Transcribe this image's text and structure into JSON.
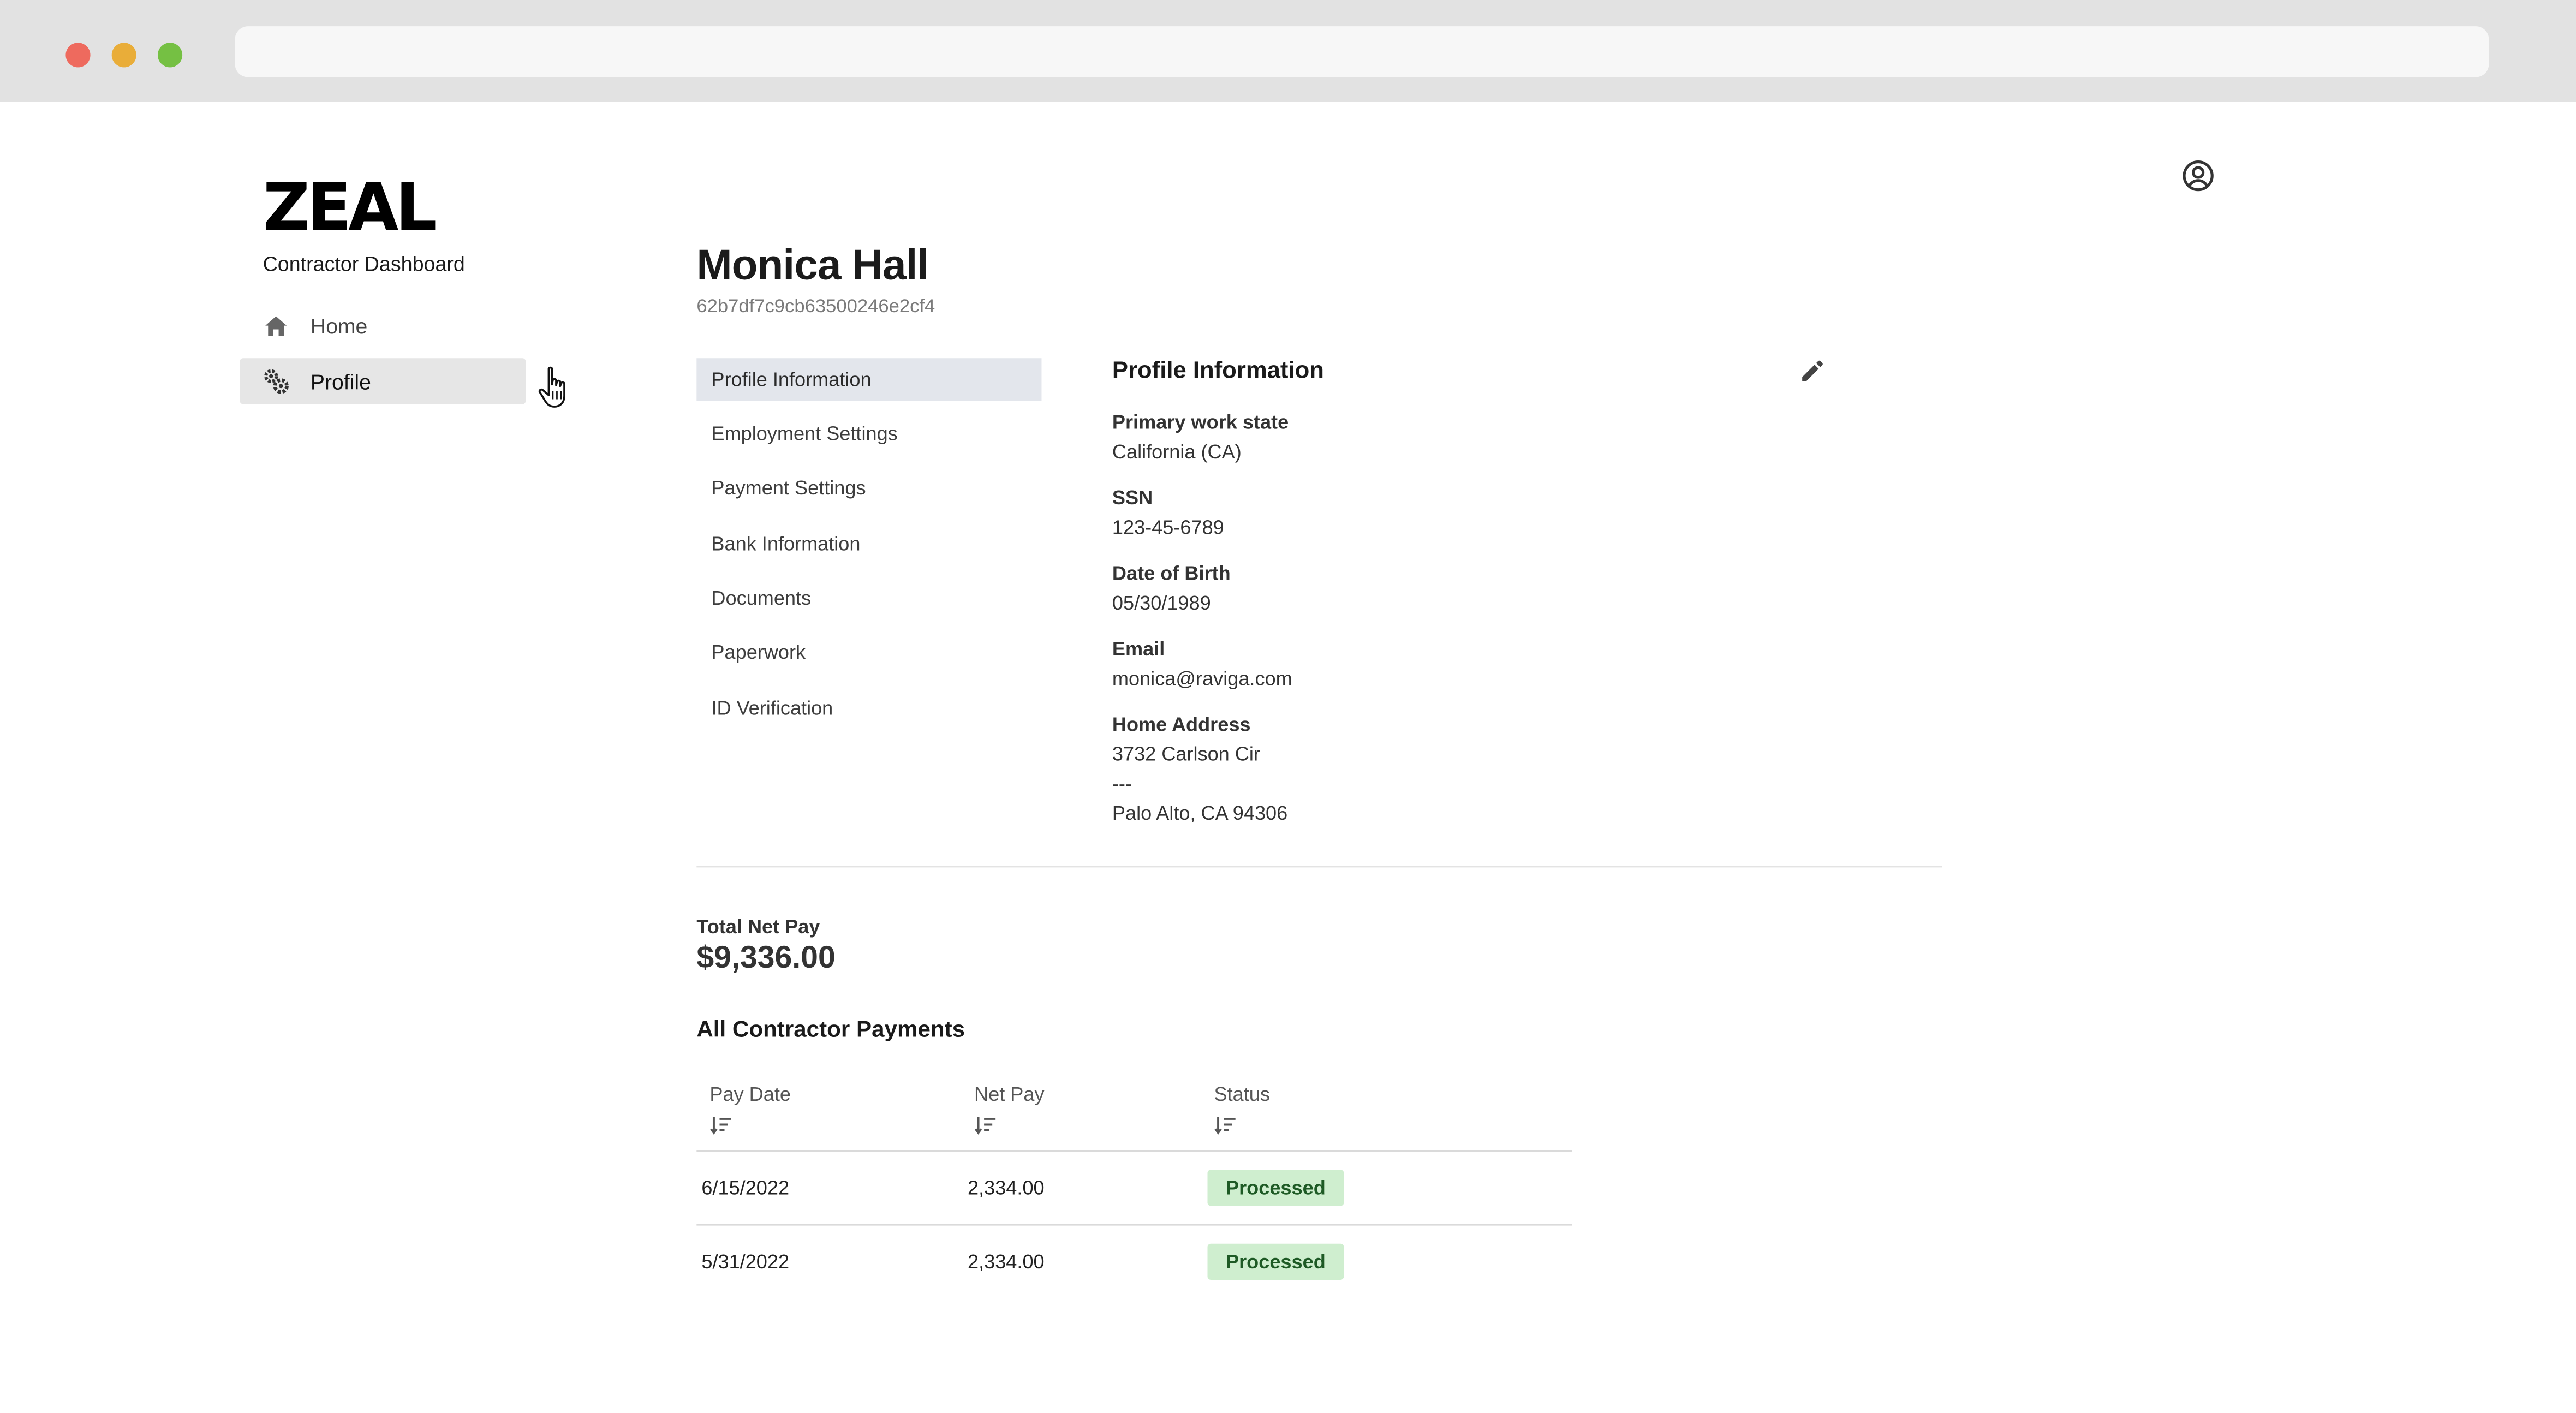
{
  "brand": {
    "logo_text": "ZEAL",
    "subtitle": "Contractor Dashboard"
  },
  "sidebar": {
    "items": [
      {
        "label": "Home",
        "icon": "home-icon"
      },
      {
        "label": "Profile",
        "icon": "gears-icon",
        "active": true
      }
    ]
  },
  "header": {
    "name": "Monica Hall",
    "id": "62b7df7c9cb63500246e2cf4"
  },
  "subnav": {
    "items": [
      {
        "label": "Profile Information",
        "active": true
      },
      {
        "label": "Employment Settings"
      },
      {
        "label": "Payment Settings"
      },
      {
        "label": "Bank Information"
      },
      {
        "label": "Documents"
      },
      {
        "label": "Paperwork"
      },
      {
        "label": "ID Verification"
      }
    ]
  },
  "profile": {
    "title": "Profile Information",
    "fields": [
      {
        "label": "Primary work state",
        "value": "California (CA)"
      },
      {
        "label": "SSN",
        "value": "123-45-6789"
      },
      {
        "label": "Date of Birth",
        "value": "05/30/1989"
      },
      {
        "label": "Email",
        "value": "monica@raviga.com"
      },
      {
        "label": "Home Address",
        "lines": [
          "3732 Carlson Cir",
          "---",
          "Palo Alto, CA 94306"
        ]
      }
    ]
  },
  "totals": {
    "label": "Total Net Pay",
    "value": "$9,336.00"
  },
  "payments": {
    "title": "All Contractor Payments",
    "columns": [
      "Pay Date",
      "Net Pay",
      "Status"
    ],
    "rows": [
      {
        "date": "6/15/2022",
        "net": "2,334.00",
        "status": "Processed"
      },
      {
        "date": "5/31/2022",
        "net": "2,334.00",
        "status": "Processed"
      }
    ]
  },
  "colors": {
    "status_processed_bg": "#cfeecf",
    "status_processed_text": "#1e5a25",
    "active_nav_bg": "#e6e6e6",
    "active_subnav_bg": "#e3e6ec"
  }
}
